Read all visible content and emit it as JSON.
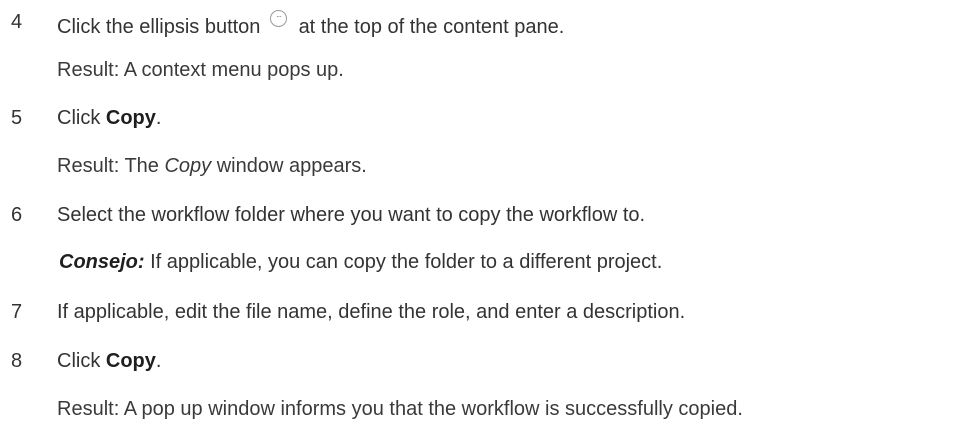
{
  "steps": [
    {
      "number": "4",
      "text_before_icon": "Click the ellipsis button",
      "icon": "ellipsis-icon",
      "icon_glyph": "···",
      "text_after_icon": "at the top of the content pane.",
      "result": "Result: A context menu pops up."
    },
    {
      "number": "5",
      "text_prefix": "Click ",
      "bold": "Copy",
      "text_suffix": ".",
      "result_prefix": "Result: The ",
      "result_italic": "Copy",
      "result_suffix": " window appears."
    },
    {
      "number": "6",
      "text": "Select the workflow folder where you want to copy the workflow to.",
      "tip_label": "Consejo:",
      "tip_text": " If applicable, you can copy the folder to a different project."
    },
    {
      "number": "7",
      "text": "If applicable, edit the file name, define the role, and enter a description."
    },
    {
      "number": "8",
      "text_prefix": "Click ",
      "bold": "Copy",
      "text_suffix": ".",
      "result": "Result: A pop up window informs you that the workflow is successfully copied."
    }
  ]
}
